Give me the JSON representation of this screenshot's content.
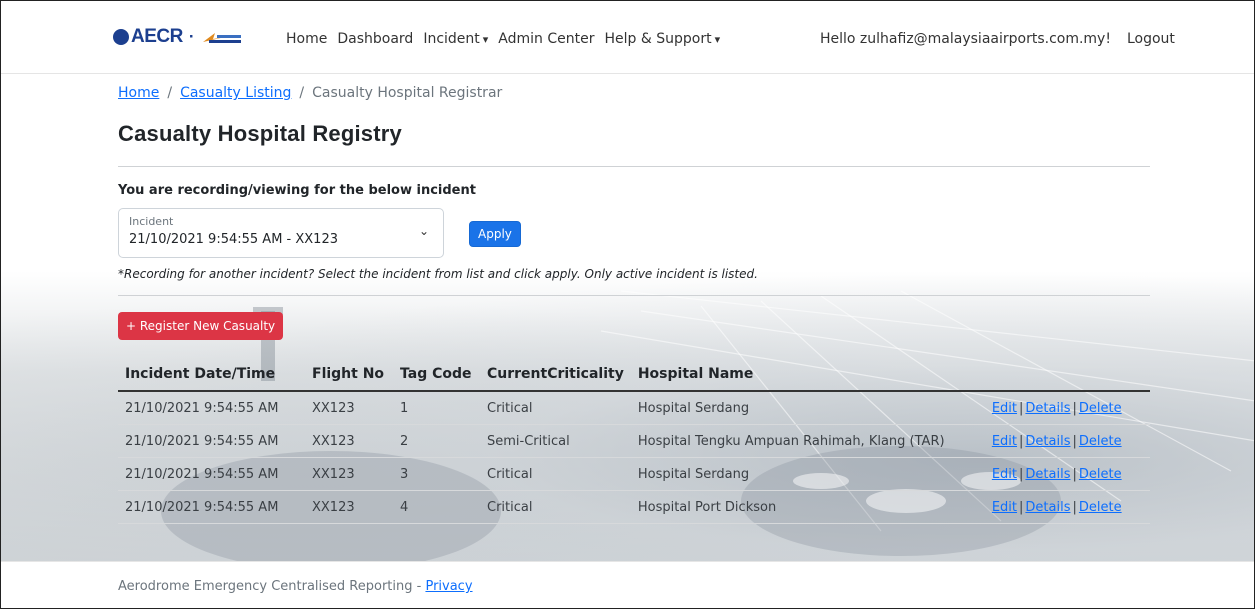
{
  "brand": {
    "name": "AECR",
    "separator": "·",
    "logo_text": "MALAYSIA AIRPORTS"
  },
  "nav": {
    "items": [
      {
        "label": "Home"
      },
      {
        "label": "Dashboard"
      },
      {
        "label": "Incident"
      },
      {
        "label": "Admin Center"
      },
      {
        "label": "Help & Support"
      }
    ],
    "greeting": "Hello zulhafiz@malaysiaairports.com.my!",
    "logout": "Logout"
  },
  "breadcrumb": {
    "home": "Home",
    "listing": "Casualty Listing",
    "current": "Casualty Hospital Registrar",
    "separator": "/"
  },
  "page": {
    "title": "Casualty Hospital Registry",
    "recording_label": "You are recording/viewing for the below incident",
    "select_label": "Incident",
    "select_value": "21/10/2021 9:54:55 AM - XX123",
    "apply_label": "Apply",
    "hint": "*Recording for another incident? Select the incident from list and click apply. Only active incident is listed.",
    "register_label": "+ Register New Casualty"
  },
  "table": {
    "headers": [
      "Incident Date/Time",
      "Flight No",
      "Tag Code",
      "CurrentCriticality",
      "Hospital Name",
      ""
    ],
    "rows": [
      {
        "datetime": "21/10/2021 9:54:55 AM",
        "flight": "XX123",
        "tag": "1",
        "criticality": "Critical",
        "hospital": "Hospital Serdang"
      },
      {
        "datetime": "21/10/2021 9:54:55 AM",
        "flight": "XX123",
        "tag": "2",
        "criticality": "Semi-Critical",
        "hospital": "Hospital Tengku Ampuan Rahimah, Klang (TAR)"
      },
      {
        "datetime": "21/10/2021 9:54:55 AM",
        "flight": "XX123",
        "tag": "3",
        "criticality": "Critical",
        "hospital": "Hospital Serdang"
      },
      {
        "datetime": "21/10/2021 9:54:55 AM",
        "flight": "XX123",
        "tag": "4",
        "criticality": "Critical",
        "hospital": "Hospital Port Dickson"
      }
    ],
    "actions": {
      "edit": "Edit",
      "details": "Details",
      "delete": "Delete",
      "sep": "|"
    }
  },
  "footer": {
    "text": "Aerodrome Emergency Centralised Reporting - ",
    "privacy": "Privacy"
  },
  "colors": {
    "brand_blue": "#1c3f8f",
    "link": "#0d6efd",
    "apply": "#1a73e8",
    "danger": "#dc3545"
  }
}
